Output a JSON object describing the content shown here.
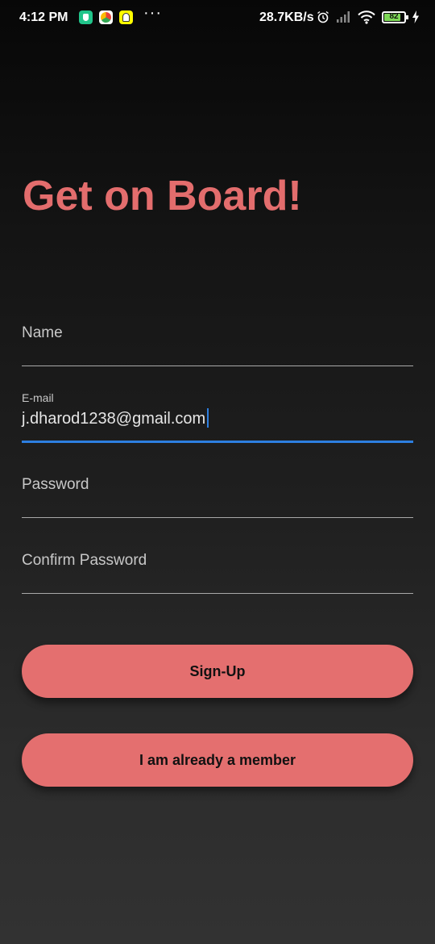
{
  "status_bar": {
    "time": "4:12 PM",
    "more": "···",
    "network_speed": "28.7KB/s",
    "battery_level": "82",
    "battery_fraction": 0.82,
    "app_icons": [
      "shield-app-icon",
      "chrome-icon",
      "snapchat-icon"
    ],
    "system_icons": [
      "alarm-icon",
      "signal-icon",
      "wifi-icon",
      "battery-icon",
      "charging-icon"
    ]
  },
  "screen": {
    "title": "Get on Board!"
  },
  "form": {
    "name": {
      "label": "Name",
      "value": ""
    },
    "email": {
      "label": "E-mail",
      "value": "j.dharod1238@gmail.com"
    },
    "password": {
      "label": "Password",
      "value": ""
    },
    "confirm_password": {
      "label": "Confirm Password",
      "value": ""
    }
  },
  "buttons": {
    "signup_label": "Sign-Up",
    "member_label": "I am already a member"
  },
  "colors": {
    "accent": "#e36d6d",
    "button": "#e46f6f",
    "focus": "#2d7fe0",
    "battery": "#7ed957"
  }
}
